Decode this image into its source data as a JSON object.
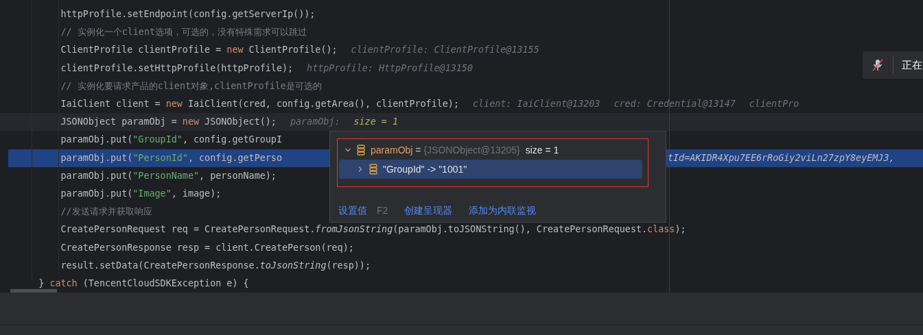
{
  "editor": {
    "lines": [
      {
        "highlighted": false,
        "current": false,
        "segments": [
          {
            "text": "        httpProfile.setEndpoint(config.getServerIp());",
            "kind": "plain"
          }
        ]
      },
      {
        "highlighted": false,
        "current": false,
        "segments": [
          {
            "text": "        // 实例化一个client选项，可选的，没有特殊需求可以跳过",
            "kind": "comment"
          }
        ]
      },
      {
        "highlighted": false,
        "current": false,
        "segments": [
          {
            "text": "        ClientProfile clientProfile = ",
            "kind": "plain"
          },
          {
            "text": "new",
            "kind": "keyword"
          },
          {
            "text": " ClientProfile();",
            "kind": "plain"
          },
          {
            "text": "clientProfile: ClientProfile@13155",
            "kind": "hint"
          }
        ]
      },
      {
        "highlighted": false,
        "current": false,
        "segments": [
          {
            "text": "        clientProfile.setHttpProfile(httpProfile);",
            "kind": "plain"
          },
          {
            "text": "httpProfile: HttpProfile@13150",
            "kind": "hint"
          }
        ]
      },
      {
        "highlighted": false,
        "current": false,
        "segments": [
          {
            "text": "        // 实例化要请求产品的client对象,clientProfile是可选的",
            "kind": "comment"
          }
        ]
      },
      {
        "highlighted": false,
        "current": false,
        "segments": [
          {
            "text": "        IaiClient client = ",
            "kind": "plain"
          },
          {
            "text": "new",
            "kind": "keyword"
          },
          {
            "text": " IaiClient(cred, config.getArea(), clientProfile);",
            "kind": "plain"
          },
          {
            "text": "client: IaiClient@13203",
            "kind": "hint"
          },
          {
            "text": "cred: Credential@13147",
            "kind": "hint"
          },
          {
            "text": "clientPro",
            "kind": "hint"
          }
        ]
      },
      {
        "highlighted": false,
        "current": true,
        "segments": [
          {
            "text": "        JSONObject paramObj = ",
            "kind": "plain"
          },
          {
            "text": "new",
            "kind": "keyword"
          },
          {
            "text": " JSONObject();",
            "kind": "plain"
          },
          {
            "text": "paramObj:",
            "kind": "hint"
          },
          {
            "text": "size = 1",
            "kind": "hint_value"
          }
        ]
      },
      {
        "highlighted": false,
        "current": false,
        "segments": [
          {
            "text": "        paramObj.put(",
            "kind": "plain"
          },
          {
            "text": "\"GroupId\"",
            "kind": "string"
          },
          {
            "text": ", config.getGroupI",
            "kind": "plain"
          }
        ]
      },
      {
        "highlighted": true,
        "current": false,
        "segments": [
          {
            "text": "        paramObj.put(",
            "kind": "plain"
          },
          {
            "text": "\"PersonId\"",
            "kind": "string"
          },
          {
            "text": ", config.getPerso",
            "kind": "plain"
          }
        ],
        "tail": "tId=AKIDR4Xpu7EE6rRoGiy2viLn27zpY8eyEMJ3,"
      },
      {
        "highlighted": false,
        "current": false,
        "segments": [
          {
            "text": "        paramObj.put(",
            "kind": "plain"
          },
          {
            "text": "\"PersonName\"",
            "kind": "string"
          },
          {
            "text": ", personName);",
            "kind": "plain"
          }
        ]
      },
      {
        "highlighted": false,
        "current": false,
        "segments": [
          {
            "text": "        paramObj.put(",
            "kind": "plain"
          },
          {
            "text": "\"Image\"",
            "kind": "string"
          },
          {
            "text": ", image);",
            "kind": "plain"
          }
        ]
      },
      {
        "highlighted": false,
        "current": false,
        "segments": [
          {
            "text": "        //发送请求并获取响应",
            "kind": "comment"
          }
        ]
      },
      {
        "highlighted": false,
        "current": false,
        "segments": [
          {
            "text": "        CreatePersonRequest req = CreatePersonRequest.",
            "kind": "plain"
          },
          {
            "text": "fromJsonString",
            "kind": "italic"
          },
          {
            "text": "(paramObj.toJSONString(), CreatePersonRequest.",
            "kind": "plain"
          },
          {
            "text": "class",
            "kind": "keyword"
          },
          {
            "text": ");",
            "kind": "plain"
          }
        ]
      },
      {
        "highlighted": false,
        "current": false,
        "segments": [
          {
            "text": "        CreatePersonResponse resp = client.CreatePerson(req);",
            "kind": "plain"
          }
        ]
      },
      {
        "highlighted": false,
        "current": false,
        "segments": [
          {
            "text": "        result.setData(CreatePersonResponse.",
            "kind": "plain"
          },
          {
            "text": "toJsonString",
            "kind": "italic"
          },
          {
            "text": "(resp));",
            "kind": "plain"
          }
        ]
      },
      {
        "highlighted": false,
        "current": false,
        "segments": [
          {
            "text": "    } ",
            "kind": "plain"
          },
          {
            "text": "catch",
            "kind": "keyword"
          },
          {
            "text": " (TencentCloudSDKException e) {",
            "kind": "plain"
          }
        ]
      }
    ]
  },
  "popup": {
    "nodes": [
      {
        "expanded": true,
        "selected": false,
        "name": "paramObj",
        "equals": " = ",
        "type": "{JSONObject@13205}",
        "value": "size = 1"
      },
      {
        "expanded": false,
        "selected": true,
        "text": "\"GroupId\" -> \"1001\""
      }
    ],
    "actions": [
      {
        "label": "设置值",
        "shortcut": "F2"
      },
      {
        "label": "创建呈现器"
      },
      {
        "label": "添加为内联监视"
      }
    ]
  },
  "notification": {
    "text": "正在"
  }
}
